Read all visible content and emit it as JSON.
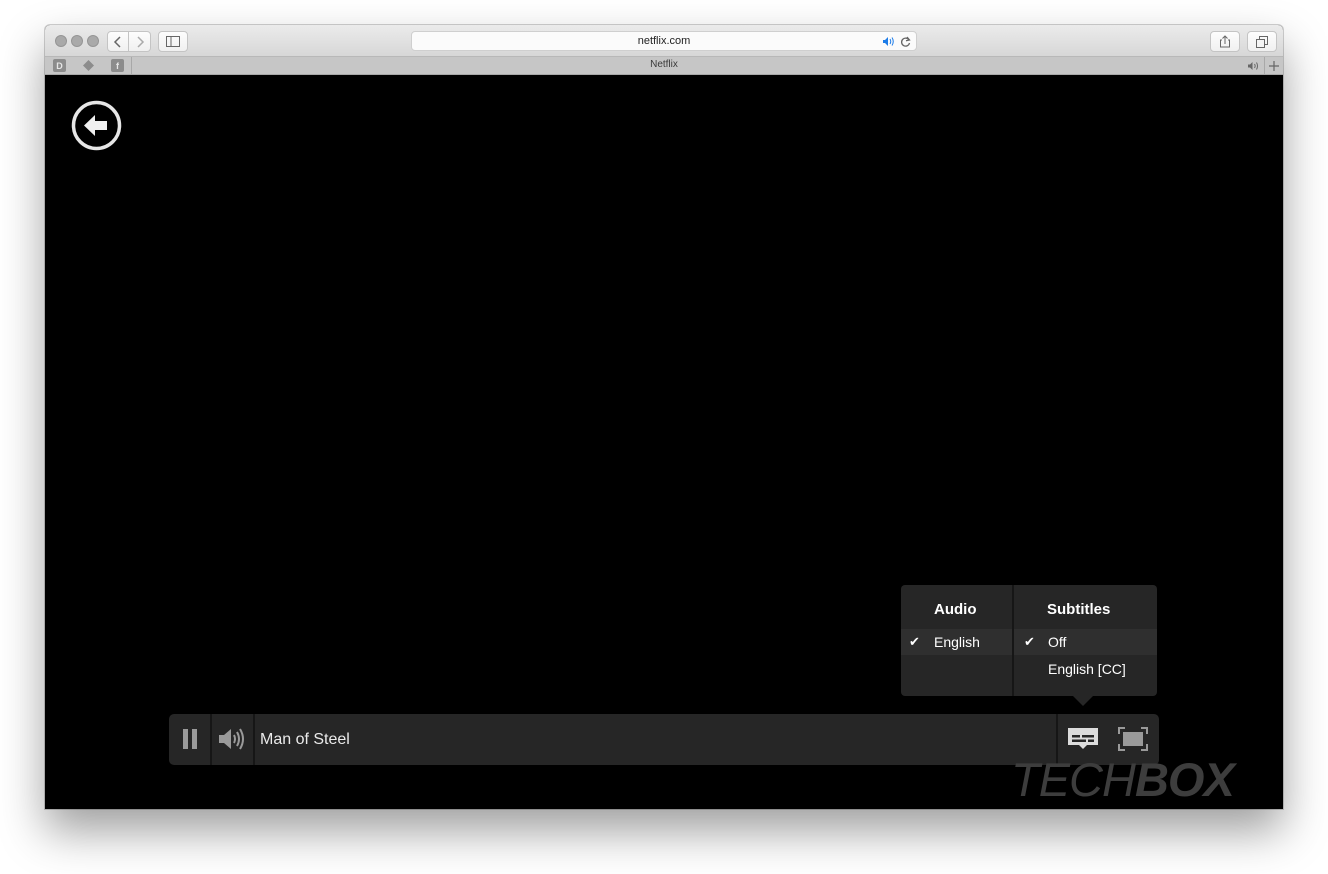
{
  "browser": {
    "address": "netflix.com",
    "tab_title": "Netflix",
    "pinned_tabs": [
      "D",
      "",
      "f"
    ]
  },
  "player": {
    "title": "Man of Steel",
    "audio": {
      "heading": "Audio",
      "options": [
        {
          "label": "English",
          "selected": true
        }
      ]
    },
    "subtitles": {
      "heading": "Subtitles",
      "options": [
        {
          "label": "Off",
          "selected": true
        },
        {
          "label": "English [CC]",
          "selected": false
        }
      ]
    }
  },
  "watermark": {
    "light": "TECH",
    "bold": "BOX"
  }
}
